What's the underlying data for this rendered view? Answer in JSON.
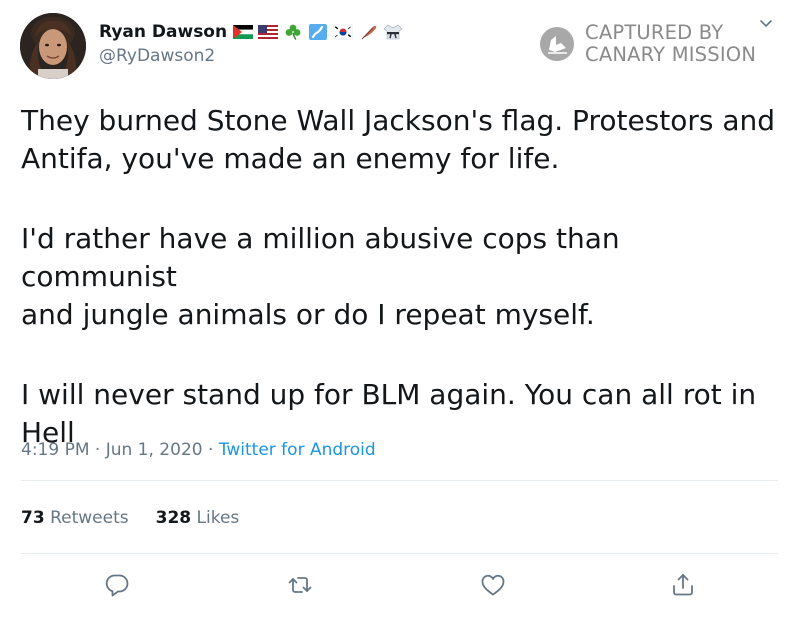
{
  "author": {
    "display_name": "Ryan Dawson",
    "handle": "@RyDawson2",
    "emojis": [
      "flag-palestine-icon",
      "flag-usa-icon",
      "shamrock-icon",
      "flag-japan-map-icon",
      "flag-south-korea-icon",
      "feather-icon",
      "martial-arts-uniform-icon"
    ]
  },
  "watermark": {
    "line1": "CAPTURED BY",
    "line2": "CANARY MISSION"
  },
  "tweet": {
    "paragraphs": [
      "They burned Stone Wall Jackson's flag. Protestors and\nAntifa, you've made an enemy for life.",
      "I'd rather have a million abusive cops than communist\nand jungle animals or do I repeat myself.",
      "I will never stand up for BLM again. You can all rot in\nHell"
    ],
    "time": "4:19 PM",
    "date": "Jun 1, 2020",
    "separator": "·",
    "source": "Twitter for Android"
  },
  "stats": {
    "retweets_count": "73",
    "retweets_label": "Retweets",
    "likes_count": "328",
    "likes_label": "Likes"
  },
  "actions": [
    "reply-icon",
    "retweet-icon",
    "like-icon",
    "share-icon"
  ],
  "colors": {
    "text": "#14171a",
    "muted": "#657786",
    "link": "#1b95e0",
    "divider": "#e6ecf0",
    "watermark": "#8a8a8a"
  }
}
